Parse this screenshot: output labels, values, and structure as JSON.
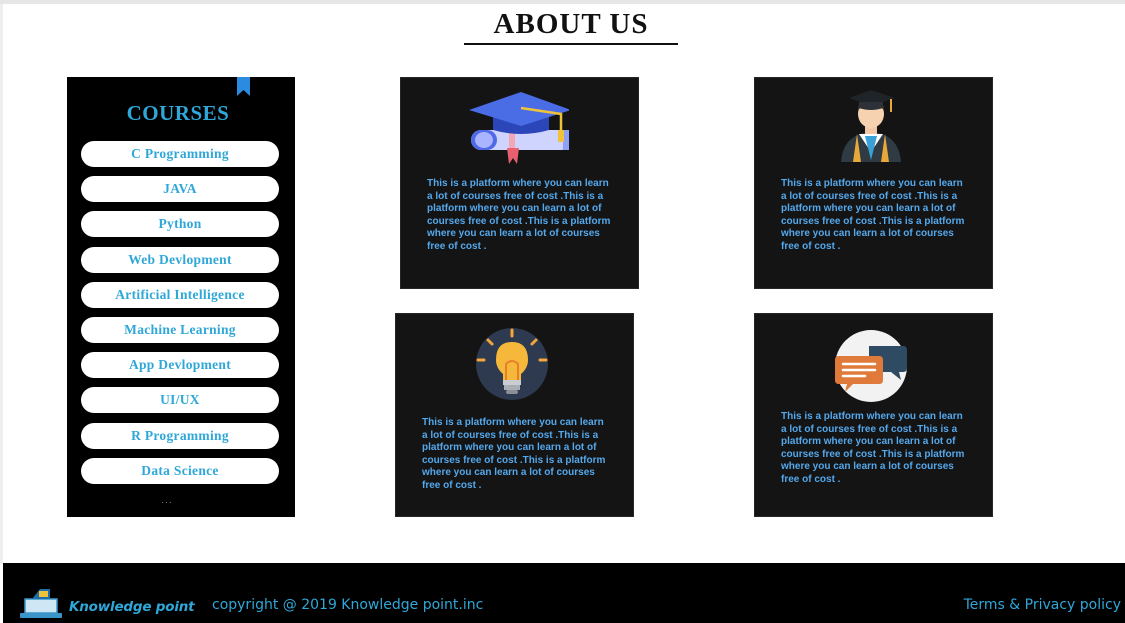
{
  "page": {
    "title": "ABOUT US"
  },
  "sidebar": {
    "title": "COURSES",
    "courses": [
      "C Programming",
      "JAVA",
      "Python",
      "Web Devlopment",
      "Artificial Intelligence",
      "Machine Learning",
      "App Devlopment",
      "UI/UX",
      "R Programming",
      "Data Science"
    ],
    "more": "..."
  },
  "cards": [
    {
      "icon": "graduation-cap-diploma-icon",
      "text": "This is a platform where you can learn a lot of courses free of cost .This is a platform where you can learn a lot of courses free of cost .This is a platform where you can learn a lot of courses free of cost ."
    },
    {
      "icon": "graduate-person-icon",
      "text": "This is a platform where you can learn a lot of courses free of cost .This is a platform where you can learn a lot of courses free of cost .This is a platform where you can learn a lot of courses free of cost ."
    },
    {
      "icon": "lightbulb-icon",
      "text": "This is a platform where you can learn a lot of courses free of cost .This is a platform where you can learn a lot of courses free of cost .This is a platform where you can learn a lot of courses free of cost ."
    },
    {
      "icon": "chat-bubbles-icon",
      "text": "This is a platform where you can learn a lot of courses free of cost .This is a platform where you can learn a lot of courses free of cost .This is a platform where you can learn a lot of courses free of cost ."
    }
  ],
  "footer": {
    "logo_icon": "laptop-book-icon",
    "brand": "Knowledge point",
    "copyright": "copyright @ 2019 Knowledge point.inc",
    "terms": "Terms & Privacy policy"
  },
  "colors": {
    "accent": "#2fa7d8",
    "card_text": "#54a8ec",
    "card_background": "#141414",
    "sidebar_background": "#000000"
  }
}
